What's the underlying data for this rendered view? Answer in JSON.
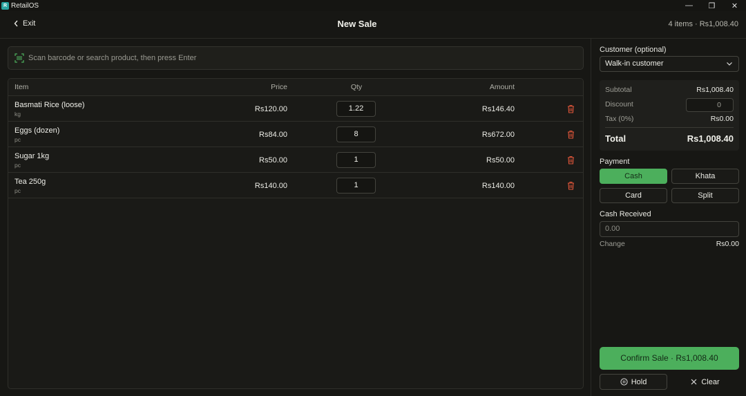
{
  "app": {
    "logo_text": "R",
    "name": "RetailOS"
  },
  "window_controls": {
    "minimize": "—",
    "restore": "❐",
    "close": "✕"
  },
  "header": {
    "exit_label": "Exit",
    "title": "New Sale",
    "summary": "4 items · Rs1,008.40"
  },
  "search": {
    "placeholder": "Scan barcode or search product, then press Enter",
    "icon": "barcode-scan-icon"
  },
  "table": {
    "columns": {
      "item": "Item",
      "price": "Price",
      "qty": "Qty",
      "amount": "Amount"
    },
    "rows": [
      {
        "name": "Basmati Rice (loose)",
        "unit": "kg",
        "price": "Rs120.00",
        "qty": "1.22",
        "amount": "Rs146.40"
      },
      {
        "name": "Eggs (dozen)",
        "unit": "pc",
        "price": "Rs84.00",
        "qty": "8",
        "amount": "Rs672.00"
      },
      {
        "name": "Sugar 1kg",
        "unit": "pc",
        "price": "Rs50.00",
        "qty": "1",
        "amount": "Rs50.00"
      },
      {
        "name": "Tea 250g",
        "unit": "pc",
        "price": "Rs140.00",
        "qty": "1",
        "amount": "Rs140.00"
      }
    ]
  },
  "customer": {
    "label": "Customer (optional)",
    "selected": "Walk-in customer"
  },
  "totals": {
    "subtotal_label": "Subtotal",
    "subtotal": "Rs1,008.40",
    "discount_label": "Discount",
    "discount_value": "0",
    "tax_label": "Tax (0%)",
    "tax": "Rs0.00",
    "total_label": "Total",
    "total": "Rs1,008.40"
  },
  "payment": {
    "label": "Payment",
    "methods": [
      "Cash",
      "Khata",
      "Card",
      "Split"
    ],
    "selected": "Cash"
  },
  "cash": {
    "label": "Cash Received",
    "placeholder": "0.00",
    "change_label": "Change",
    "change": "Rs0.00"
  },
  "actions": {
    "confirm": "Confirm Sale · Rs1,008.40",
    "hold": "Hold",
    "clear": "Clear"
  },
  "colors": {
    "accent": "#4caf5c",
    "delete": "#e0563a",
    "logo": "#2aa4a0",
    "background": "#171714"
  }
}
